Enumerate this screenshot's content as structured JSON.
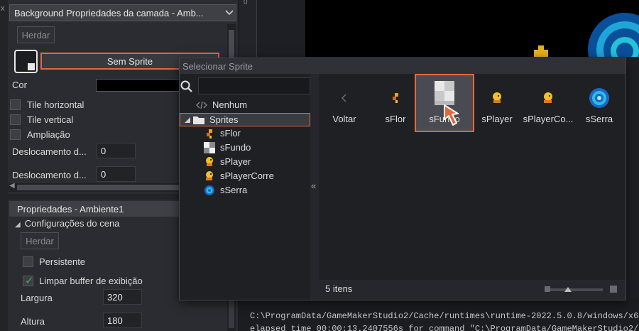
{
  "inspector": {
    "close_glyph": "x",
    "layer_title": "Background Propriedades da camada - Amb...",
    "inherit_label": "Herdar",
    "sprite_button_label": "Sem Sprite",
    "color_label": "Cor",
    "tile_horizontal_label": "Tile horizontal",
    "tile_vertical_label": "Tile vertical",
    "stretch_label": "Ampliação",
    "offset_x_label": "Deslocamento d...",
    "offset_x_value": "0",
    "offset_y_label": "Deslocamento d...",
    "offset_y_value": "0"
  },
  "room_props": {
    "header": "Propriedades - Ambiente1",
    "section_label": "Configurações do cena",
    "inherit_label": "Herdar",
    "persistent_label": "Persistente",
    "clear_buffer_label": "Limpar buffer de exibição",
    "clear_buffer_checked": true,
    "width_label": "Largura",
    "width_value": "320",
    "height_label": "Altura",
    "height_value": "180"
  },
  "room_editor": {
    "ruler_value": "0"
  },
  "output": {
    "line1": "C:\\ProgramData/GameMakerStudio2/Cache/runtimes\\runtime-2022.5.0.8/windows/x64/Ru",
    "line2": "elapsed time 00:00:13.2407556s for command \"C:\\ProgramData/GameMakerStudio2/Cach"
  },
  "sprite_dialog": {
    "title": "Selecionar Sprite",
    "search_placeholder": "",
    "tree": {
      "none_label": "Nenhum",
      "folder_label": "Sprites",
      "items": [
        "sFlor",
        "sFundo",
        "sPlayer",
        "sPlayerCorre",
        "sSerra"
      ]
    },
    "grid": {
      "back_label": "Voltar",
      "items": [
        "sFlor",
        "sFundo",
        "sPlayer",
        "sPlayerCo...",
        "sSerra"
      ],
      "selected": "sFundo"
    },
    "item_count": "5 itens"
  },
  "colors": {
    "accent": "#e4683a",
    "check": "#2fb34d",
    "panel": "#2b2c31"
  }
}
